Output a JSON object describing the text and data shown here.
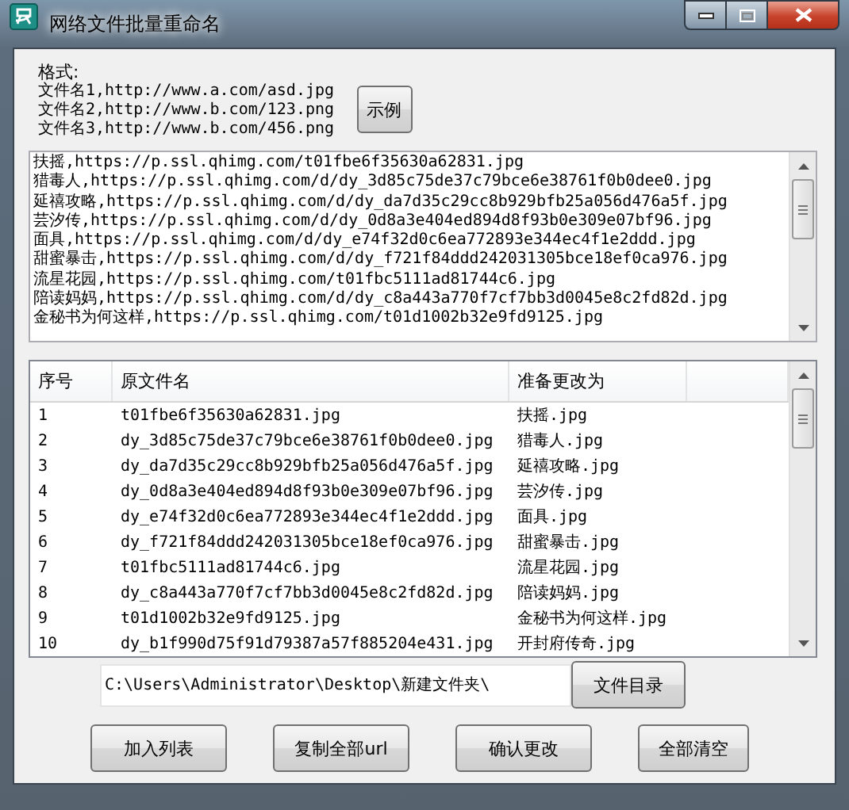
{
  "window": {
    "title": "网络文件批量重命名"
  },
  "format": {
    "heading": "格式:",
    "lines": [
      "文件名1,http://www.a.com/asd.jpg",
      "文件名2,http://www.b.com/123.png",
      "文件名3,http://www.b.com/456.png"
    ]
  },
  "example_button": "示例",
  "url_text": {
    "lines": [
      "扶摇,https://p.ssl.qhimg.com/t01fbe6f35630a62831.jpg",
      "猎毒人,https://p.ssl.qhimg.com/d/dy_3d85c75de37c79bce6e38761f0b0dee0.jpg",
      "延禧攻略,https://p.ssl.qhimg.com/d/dy_da7d35c29cc8b929bfb25a056d476a5f.jpg",
      "芸汐传,https://p.ssl.qhimg.com/d/dy_0d8a3e404ed894d8f93b0e309e07bf96.jpg",
      "面具,https://p.ssl.qhimg.com/d/dy_e74f32d0c6ea772893e344ec4f1e2ddd.jpg",
      "甜蜜暴击,https://p.ssl.qhimg.com/d/dy_f721f84ddd242031305bce18ef0ca976.jpg",
      "流星花园,https://p.ssl.qhimg.com/t01fbc5111ad81744c6.jpg",
      "陪读妈妈,https://p.ssl.qhimg.com/d/dy_c8a443a770f7cf7bb3d0045e8c2fd82d.jpg",
      "金秘书为何这样,https://p.ssl.qhimg.com/t01d1002b32e9fd9125.jpg"
    ]
  },
  "table": {
    "columns": [
      "序号",
      "原文件名",
      "准备更改为"
    ],
    "rows": [
      [
        "1",
        "t01fbe6f35630a62831.jpg",
        "扶摇.jpg"
      ],
      [
        "2",
        "dy_3d85c75de37c79bce6e38761f0b0dee0.jpg",
        "猎毒人.jpg"
      ],
      [
        "3",
        "dy_da7d35c29cc8b929bfb25a056d476a5f.jpg",
        "延禧攻略.jpg"
      ],
      [
        "4",
        "dy_0d8a3e404ed894d8f93b0e309e07bf96.jpg",
        "芸汐传.jpg"
      ],
      [
        "5",
        "dy_e74f32d0c6ea772893e344ec4f1e2ddd.jpg",
        "面具.jpg"
      ],
      [
        "6",
        "dy_f721f84ddd242031305bce18ef0ca976.jpg",
        "甜蜜暴击.jpg"
      ],
      [
        "7",
        "t01fbc5111ad81744c6.jpg",
        "流星花园.jpg"
      ],
      [
        "8",
        "dy_c8a443a770f7cf7bb3d0045e8c2fd82d.jpg",
        "陪读妈妈.jpg"
      ],
      [
        "9",
        "t01d1002b32e9fd9125.jpg",
        "金秘书为何这样.jpg"
      ],
      [
        "10",
        "dy_b1f990d75f91d79387a57f885204e431.jpg",
        "开封府传奇.jpg"
      ]
    ]
  },
  "path_field": {
    "value": "C:\\Users\\Administrator\\Desktop\\新建文件夹\\"
  },
  "browse_button": "文件目录",
  "buttons": [
    "加入列表",
    "复制全部url",
    "确认更改",
    "全部清空"
  ]
}
